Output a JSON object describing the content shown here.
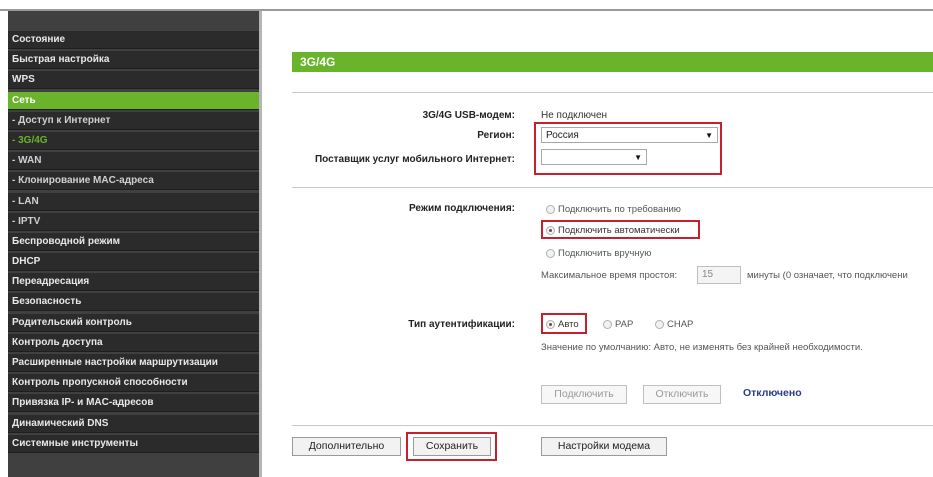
{
  "sidebar": {
    "items": [
      {
        "label": "Состояние"
      },
      {
        "label": "Быстрая настройка"
      },
      {
        "label": "WPS"
      },
      {
        "label": "Сеть"
      },
      {
        "label": "- Доступ к Интернет"
      },
      {
        "label": "- 3G/4G"
      },
      {
        "label": "- WAN"
      },
      {
        "label": "- Клонирование MAC-адреса"
      },
      {
        "label": "- LAN"
      },
      {
        "label": "- IPTV"
      },
      {
        "label": "Беспроводной режим"
      },
      {
        "label": "DHCP"
      },
      {
        "label": "Переадресация"
      },
      {
        "label": "Безопасность"
      },
      {
        "label": "Родительский контроль"
      },
      {
        "label": "Контроль доступа"
      },
      {
        "label": "Расширенные настройки маршрутизации"
      },
      {
        "label": "Контроль пропускной способности"
      },
      {
        "label": "Привязка IP- и MAC-адресов"
      },
      {
        "label": "Динамический DNS"
      },
      {
        "label": "Системные инструменты"
      }
    ],
    "active_item": "Сеть",
    "current_subitem": "- 3G/4G"
  },
  "page": {
    "title": "3G/4G"
  },
  "form": {
    "modem_label": "3G/4G USB-модем:",
    "modem_value": "Не подключен",
    "region_label": "Регион:",
    "region_value": "Россия",
    "provider_label": "Поставщик услуг мобильного Интернет:",
    "provider_value": "",
    "mode_label": "Режим подключения:",
    "mode_options": [
      {
        "label": "Подключить по требованию",
        "selected": false
      },
      {
        "label": "Подключить автоматически",
        "selected": true
      },
      {
        "label": "Подключить вручную",
        "selected": false
      }
    ],
    "idle_label": "Максимальное время простоя:",
    "idle_value": "15",
    "idle_suffix": "минуты (0 означает, что подключени",
    "auth_label": "Тип аутентификации:",
    "auth_options": [
      {
        "label": "Авто",
        "selected": true
      },
      {
        "label": "PAP",
        "selected": false
      },
      {
        "label": "CHAP",
        "selected": false
      }
    ],
    "auth_hint": "Значение по умолчанию: Авто, не изменять без крайней необходимости.",
    "connect_button": "Подключить",
    "disconnect_button": "Отключить",
    "connection_status": "Отключено"
  },
  "footer": {
    "advanced_button": "Дополнительно",
    "save_button": "Сохранить",
    "modem_settings_button": "Настройки модема"
  },
  "colors": {
    "accent_green": "#6ab42b",
    "highlight_red": "#c5202e",
    "sidebar_bg": "#2b2b2b",
    "status_blue": "#2a3a8c"
  }
}
